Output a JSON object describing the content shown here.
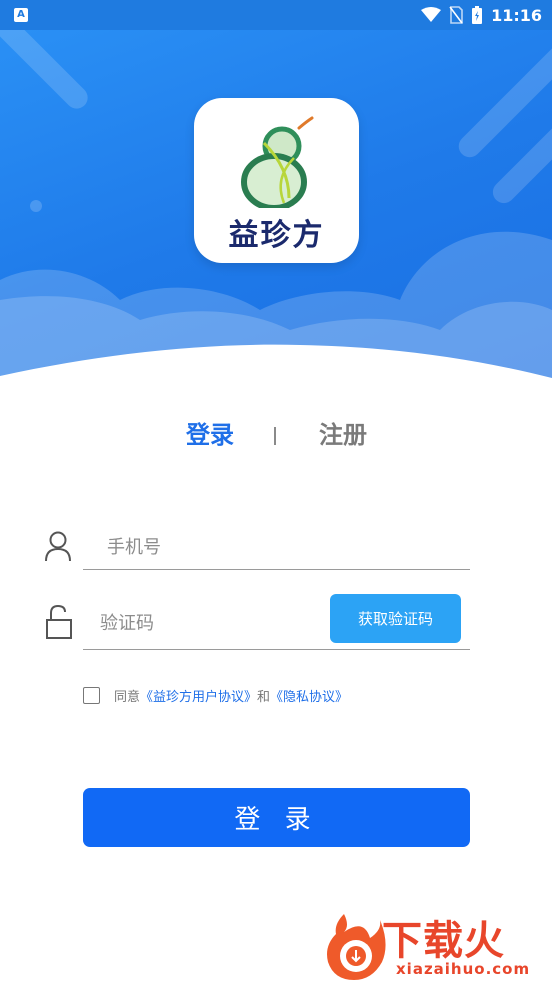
{
  "status_bar": {
    "time": "11:16",
    "app_icon_letter": "A",
    "icons": [
      "wifi-icon",
      "no-sim-icon",
      "battery-charging-icon"
    ]
  },
  "logo": {
    "text": "益珍方",
    "icon": "gourd-logo-icon"
  },
  "tabs": {
    "login": "登录",
    "divider": "|",
    "register": "注册"
  },
  "form": {
    "phone_placeholder": "手机号",
    "phone_value": "",
    "phone_icon": "user-icon",
    "code_placeholder": "验证码",
    "code_value": "",
    "code_icon": "lock-icon",
    "get_code_button": "获取验证码"
  },
  "agreement": {
    "prefix": "同意",
    "user_agreement": "《益珍方用户协议》",
    "and": "和",
    "privacy": "《隐私协议》",
    "checked": false
  },
  "submit_button": "登 录",
  "watermark": {
    "title": "下载火",
    "subtitle": "xiazaihuo.com",
    "icon": "flame-logo-icon"
  },
  "colors": {
    "header_blue": "#1f7be0",
    "accent_blue": "#1169f5",
    "code_button": "#2ca3f5",
    "watermark_red": "#e8462b"
  }
}
